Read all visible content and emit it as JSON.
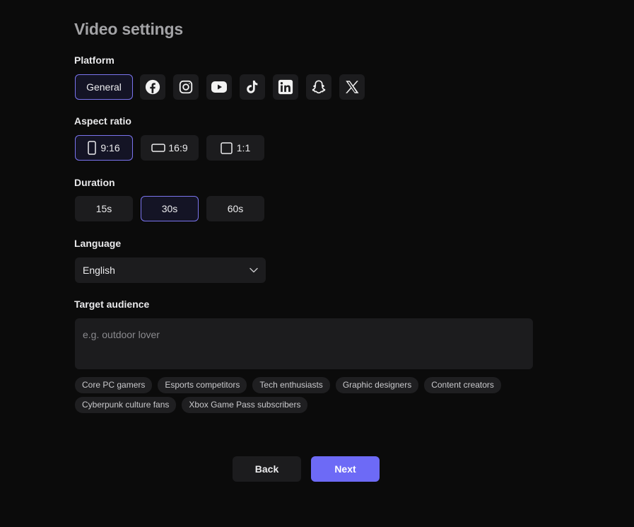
{
  "header": {
    "title": "Video settings"
  },
  "platform": {
    "label": "Platform",
    "general_label": "General",
    "selected": "General",
    "icons": [
      "facebook-icon",
      "instagram-icon",
      "youtube-icon",
      "tiktok-icon",
      "linkedin-icon",
      "snapchat-icon",
      "x-icon"
    ]
  },
  "aspect_ratio": {
    "label": "Aspect ratio",
    "options": [
      {
        "label": "9:16",
        "icon": "portrait-rect-icon"
      },
      {
        "label": "16:9",
        "icon": "landscape-rect-icon"
      },
      {
        "label": "1:1",
        "icon": "square-rect-icon"
      }
    ],
    "selected": "9:16"
  },
  "duration": {
    "label": "Duration",
    "options": [
      "15s",
      "30s",
      "60s"
    ],
    "selected": "30s"
  },
  "language": {
    "label": "Language",
    "value": "English",
    "icon": "chevron-down-icon"
  },
  "audience": {
    "label": "Target audience",
    "placeholder": "e.g. outdoor lover",
    "value": "",
    "suggestions": [
      "Core PC gamers",
      "Esports competitors",
      "Tech enthusiasts",
      "Graphic designers",
      "Content creators",
      "Cyberpunk culture fans",
      "Xbox Game Pass subscribers"
    ]
  },
  "footer": {
    "back_label": "Back",
    "next_label": "Next"
  },
  "colors": {
    "accent": "#6d6af6",
    "selected_border": "#7a74ee",
    "surface": "#1c1c1e",
    "background": "#0b0b0b"
  }
}
